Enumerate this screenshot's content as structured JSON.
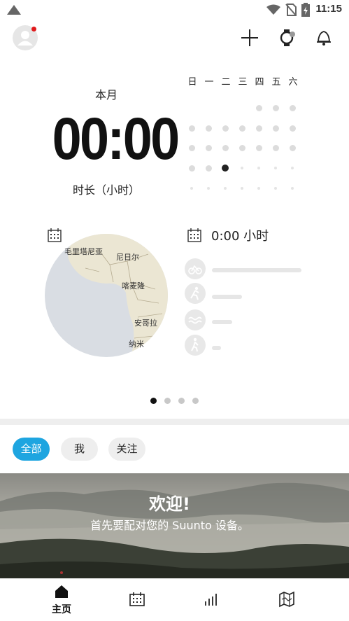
{
  "status_bar": {
    "time": "11:15"
  },
  "summary": {
    "period_label": "本月",
    "total_time": "00:00",
    "duration_label": "时长（小时）"
  },
  "calendar": {
    "weekdays": [
      "日",
      "一",
      "二",
      "三",
      "四",
      "五",
      "六"
    ]
  },
  "map": {
    "labels": [
      "毛里塔尼亚",
      "尼日尔",
      "喀麦隆",
      "安哥拉",
      "纳米"
    ]
  },
  "activity_summary": {
    "hours_text": "0:00 小时"
  },
  "filters": {
    "all": "全部",
    "me": "我",
    "following": "关注"
  },
  "banner": {
    "title": "欢迎!",
    "subtitle": "首先要配对您的 Suunto 设备。"
  },
  "bottom_nav": {
    "home_label": "主页"
  },
  "colors": {
    "accent": "#1ea5e0",
    "notification_dot": "#e0191b"
  },
  "icons": [
    "wifi-icon",
    "no-sim-icon",
    "battery-icon",
    "avatar-icon",
    "add-icon",
    "watch-icon",
    "bell-icon",
    "calendar-icon",
    "cycling-icon",
    "running-icon",
    "swimming-icon",
    "hiking-icon",
    "home-icon",
    "map-icon",
    "stats-icon"
  ]
}
